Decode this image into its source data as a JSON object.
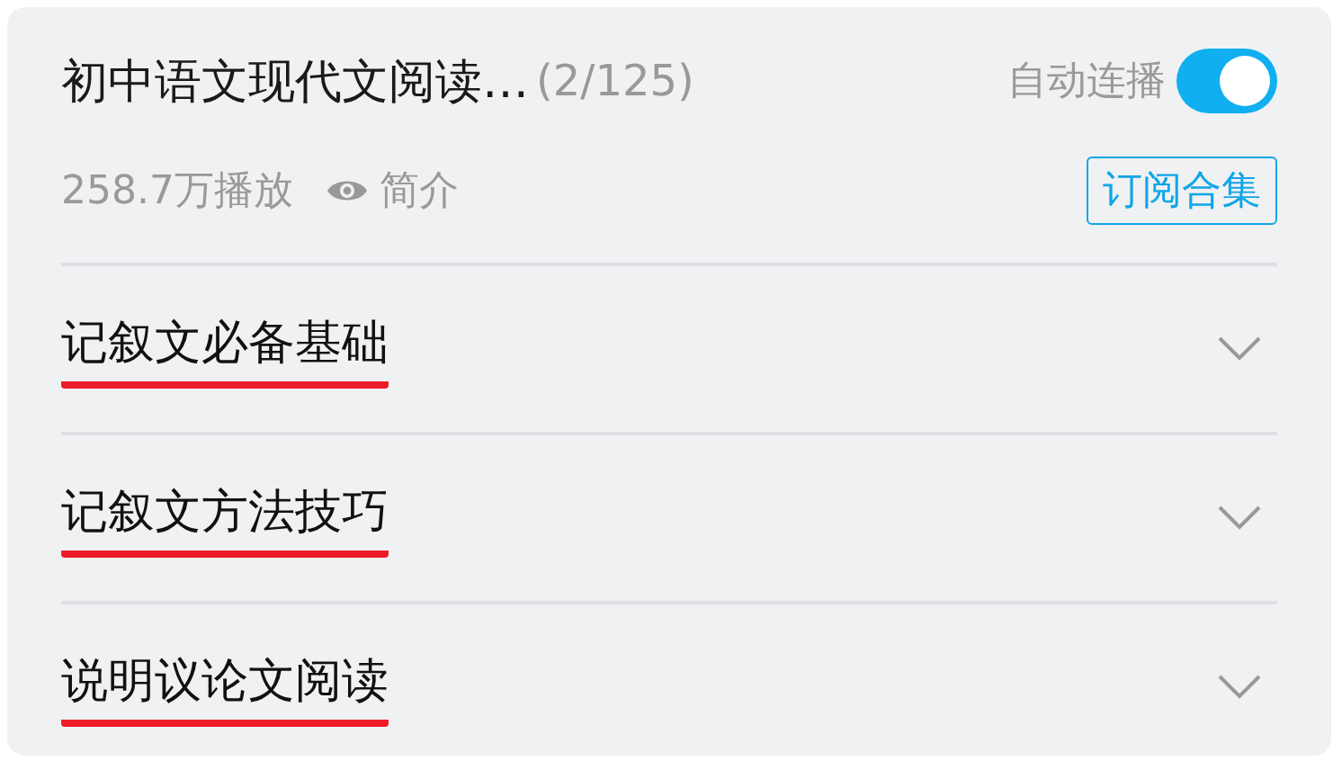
{
  "header": {
    "title": "初中语文现代文阅读…",
    "count": "(2/125)",
    "autoplay": {
      "label": "自动连播",
      "on": true
    },
    "plays": "258.7万播放",
    "intro": "简介",
    "subscribe": "订阅合集"
  },
  "sections": [
    {
      "title": "记叙文必备基础",
      "expanded": false,
      "underlined": true
    },
    {
      "title": "记叙文方法技巧",
      "expanded": false,
      "underlined": true
    },
    {
      "title": "说明议论文阅读",
      "expanded": false,
      "underlined": true
    }
  ]
}
